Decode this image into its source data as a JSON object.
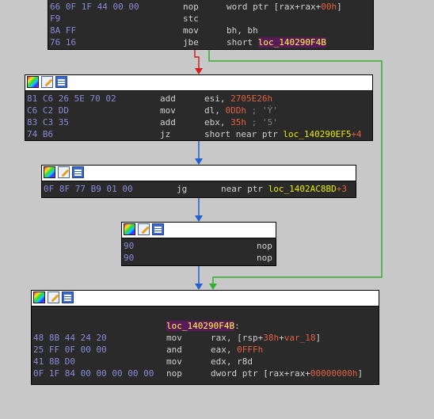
{
  "block_top": {
    "lines": [
      {
        "bytes": "66 0F 1F 44 00 00",
        "mnem": "nop",
        "op": [
          "word ptr [rax+rax+",
          "00h",
          "]"
        ]
      },
      {
        "bytes": "F9",
        "mnem": "stc",
        "op": [
          "",
          "",
          ""
        ]
      },
      {
        "bytes": "8A FF",
        "mnem": "mov",
        "op": [
          "bh, bh",
          "",
          ""
        ]
      },
      {
        "bytes": "76 16",
        "mnem": "jbe",
        "op": [
          "short ",
          "loc_140290F4B",
          ""
        ]
      }
    ]
  },
  "block2": {
    "lines": [
      {
        "bytes": "81 C6 26 5E 70 02",
        "mnem": "add",
        "op": "esi, ",
        "imm": "2705E26h",
        "cmt": ""
      },
      {
        "bytes": "C6 C2 DD",
        "mnem": "mov",
        "op": "dl, ",
        "imm": "0DDh",
        "cmt": " ; 'Ý'"
      },
      {
        "bytes": "83 C3 35",
        "mnem": "add",
        "op": "ebx, ",
        "imm": "35h",
        "cmt": " ; '5'"
      },
      {
        "bytes": "74 B6",
        "mnem": "jz",
        "op": "short near ptr ",
        "label": "loc_140290EF5",
        "plus": "+4"
      }
    ]
  },
  "block3": {
    "lines": [
      {
        "bytes": "0F 8F 77 B9 01 00",
        "mnem": "jg",
        "op": "near ptr ",
        "label": "loc_1402AC8BD",
        "plus": "+3"
      }
    ]
  },
  "block4": {
    "lines": [
      {
        "bytes": "90",
        "mnem": "nop"
      },
      {
        "bytes": "90",
        "mnem": "nop"
      }
    ]
  },
  "block5": {
    "label": "loc_140290F4B",
    "colon": ":",
    "lines": [
      {
        "bytes": "48 8B 44 24 20",
        "mnem": "mov",
        "op": "rax, [rsp+",
        "imm": "38h",
        "op2": "+",
        "var": "var_18",
        "op3": "]"
      },
      {
        "bytes": "25 FF 0F 00 00",
        "mnem": "and",
        "op": "eax, ",
        "imm": "0FFFh"
      },
      {
        "bytes": "41 8B D0",
        "mnem": "mov",
        "op": "edx, r8d"
      },
      {
        "bytes": "0F 1F 84 00 00 00 00 00",
        "mnem": "nop",
        "op": "dword ptr [rax+rax+",
        "imm": "00000000h",
        "op3": "]"
      }
    ]
  },
  "colors": {
    "bg": "#c8c8c8",
    "block": "#2a2a2a",
    "bytes": "#8a8ad8",
    "immediate": "#e06040",
    "label": "#ffff40",
    "label_bg": "#5a1a5a",
    "edge_true": "#2060d0",
    "edge_false": "#d02020",
    "edge_jump": "#30b030"
  }
}
